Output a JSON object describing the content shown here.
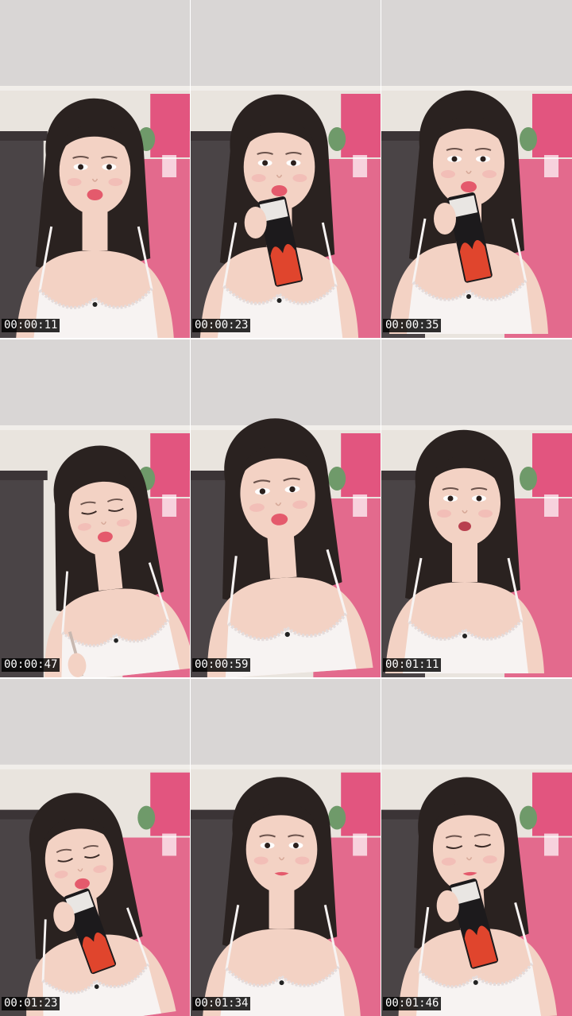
{
  "frames": [
    {
      "timestamp": "00:00:11",
      "subject": "girl in white camisole facing camera, lips pursed",
      "holding": "none"
    },
    {
      "timestamp": "00:00:23",
      "subject": "girl eating from a black snack wrapper",
      "holding": "black snack wrapper"
    },
    {
      "timestamp": "00:00:35",
      "subject": "girl biting snack, looking down",
      "holding": "black snack wrapper"
    },
    {
      "timestamp": "00:00:47",
      "subject": "girl eyes closed, looking down",
      "holding": "pen"
    },
    {
      "timestamp": "00:00:59",
      "subject": "girl close to camera, lips pursed",
      "holding": "none"
    },
    {
      "timestamp": "00:01:11",
      "subject": "girl talking, mouth open",
      "holding": "none"
    },
    {
      "timestamp": "00:01:23",
      "subject": "girl opening a snack wrapper",
      "holding": "snack wrapper"
    },
    {
      "timestamp": "00:01:34",
      "subject": "girl facing camera, neutral",
      "holding": "none"
    },
    {
      "timestamp": "00:01:46",
      "subject": "girl holding snack near mouth",
      "holding": "black snack wrapper"
    }
  ],
  "colors": {
    "ceiling": "#d9d6d5",
    "wall": "#e9e4de",
    "pink_wall": "#e2557f",
    "skin": "#f3d2c4",
    "hair": "#2a2220",
    "camisole": "#f7f3f2",
    "timestamp_bg": "#000000",
    "timestamp_text": "#ffffff"
  }
}
